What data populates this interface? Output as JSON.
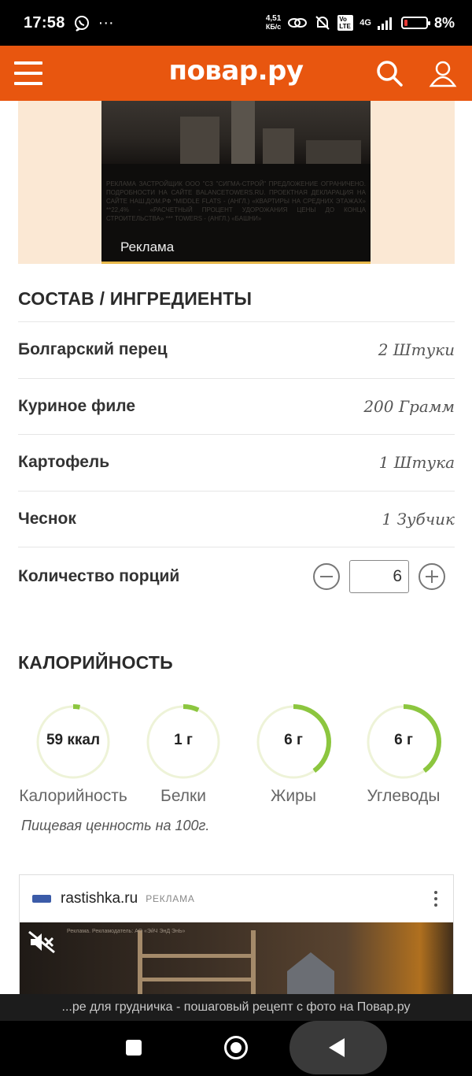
{
  "status_bar": {
    "time": "17:58",
    "net_speed_value": "4,51",
    "net_speed_unit": "КБ/с",
    "volte": "Vo LTE",
    "network": "4G",
    "battery_percent": "8%",
    "icons": [
      "viber-icon",
      "more-dots-icon",
      "link-icon",
      "mute-bell-icon",
      "volte-icon",
      "signal-icon",
      "battery-icon"
    ]
  },
  "header": {
    "logo": "повар.ру",
    "icons": [
      "menu-icon",
      "search-icon",
      "user-icon"
    ],
    "accent_color": "#e8560f"
  },
  "top_ad": {
    "disclaimer": "РЕКЛАМА ЗАСТРОЙЩИК ООО \"СЗ \"СИГМА-СТРОЙ\" ПРЕДЛОЖЕНИЕ ОГРАНИЧЕНО. ПОДРОБНОСТИ НА САЙТЕ BALANCETOWERS.RU. ПРОЕКТНАЯ ДЕКЛАРАЦИЯ НА САЙТЕ НАШ.ДОМ.РФ *MIDDLE FLATS - (АНГЛ.) «КВАРТИРЫ НА СРЕДНИХ ЭТАЖАХ» **22,4% - «РАСЧЕТНЫЙ ПРОЦЕНТ УДОРОЖАНИЯ ЦЕНЫ ДО КОНЦА СТРОИТЕЛЬСТВА» *** TOWERS - (АНГЛ.) «БАШНИ»",
    "label": "Реклама"
  },
  "ingredients": {
    "title": "СОСТАВ / ИНГРЕДИЕНТЫ",
    "items": [
      {
        "name": "Болгарский перец",
        "qty": "2 Штуки"
      },
      {
        "name": "Куриное филе",
        "qty": "200 Грамм"
      },
      {
        "name": "Картофель",
        "qty": "1 Штука"
      },
      {
        "name": "Чеснок",
        "qty": "1 Зубчик"
      }
    ],
    "portions_label": "Количество порций",
    "portions_value": "6"
  },
  "calories": {
    "title": "КАЛОРИЙНОСТЬ",
    "items": [
      {
        "value": "59 ккал",
        "label": "Калорийность",
        "fraction": 0.03
      },
      {
        "value": "1 г",
        "label": "Белки",
        "fraction": 0.07
      },
      {
        "value": "6 г",
        "label": "Жиры",
        "fraction": 0.4
      },
      {
        "value": "6 г",
        "label": "Углеводы",
        "fraction": 0.4
      }
    ],
    "ring_color": "#8cc63f",
    "ring_track_color": "#eef3d8",
    "note": "Пищевая ценность на 100г."
  },
  "bottom_ad": {
    "domain": "rastishka.ru",
    "tag": "РЕКЛАМА",
    "small_text": "Реклама. Рекламодатель: АО «ЭйЧ ЭнД ЭнЬ»"
  },
  "bottom_banner": {
    "text": "...ре для грудничка - пошаговый рецепт с фото на Повар.ру"
  }
}
